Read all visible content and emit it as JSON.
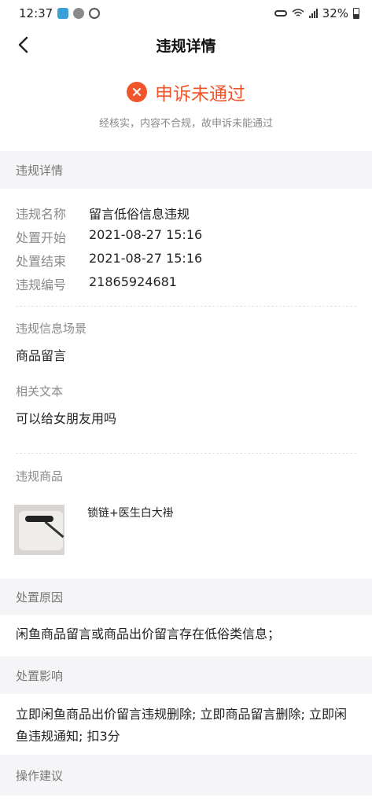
{
  "status_bar": {
    "time": "12:37",
    "battery": "32%"
  },
  "nav": {
    "title": "违规详情"
  },
  "result": {
    "title": "申诉未通过",
    "subtitle": "经核实，内容不合规，故申诉未能通过"
  },
  "details": {
    "header": "违规详情",
    "rows": [
      {
        "key": "违规名称",
        "value": "留言低俗信息违规"
      },
      {
        "key": "处置开始",
        "value": "2021-08-27 15:16"
      },
      {
        "key": "处置结束",
        "value": "2021-08-27 15:16"
      },
      {
        "key": "违规编号",
        "value": "21865924681"
      }
    ],
    "scene_label": "违规信息场景",
    "scene_value": "商品留言",
    "text_label": "相关文本",
    "text_value": "可以给女朋友用吗"
  },
  "product": {
    "header": "违规商品",
    "title": "锁链+医生白大褂"
  },
  "reason": {
    "header": "处置原因",
    "text": "闲鱼商品留言或商品出价留言存在低俗类信息；"
  },
  "impact": {
    "header": "处置影响",
    "text": "立即闲鱼商品出价留言违规删除; 立即商品留言删除; 立即闲鱼违规通知; 扣3分"
  },
  "advice": {
    "header": "操作建议"
  },
  "colors": {
    "accent": "#f0552b",
    "section_bg": "#f5f5f8"
  }
}
